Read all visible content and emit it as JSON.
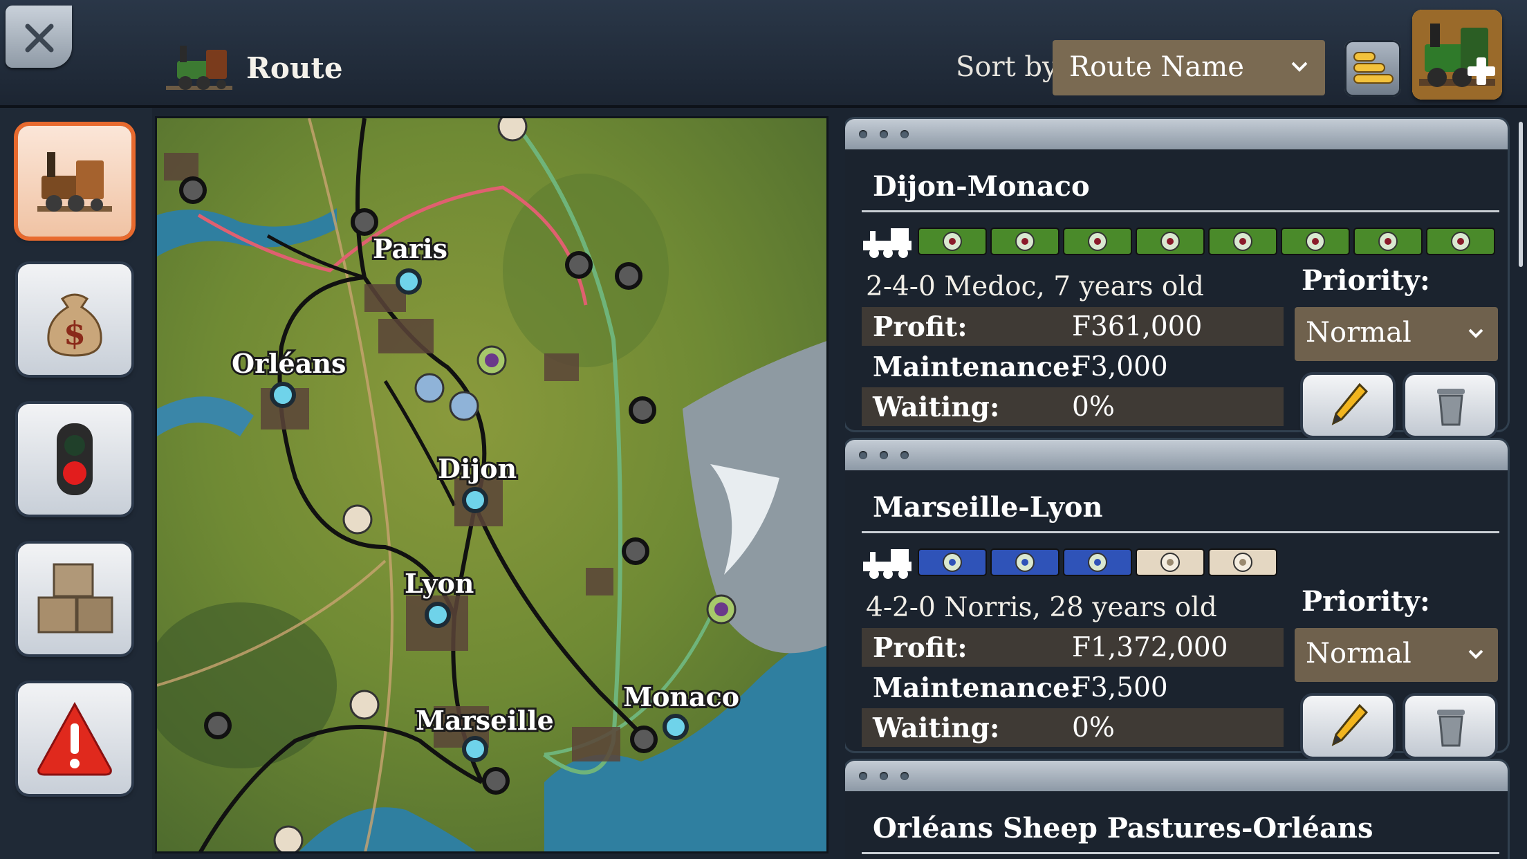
{
  "header": {
    "title": "Route",
    "sort_label": "Sort by:",
    "sort_value": "Route Name",
    "icons": {
      "close": "close-icon",
      "title": "locomotive-icon",
      "sort_order": "sort-order-icon",
      "add_train": "add-train-icon"
    }
  },
  "sidebar": {
    "items": [
      {
        "name": "trains",
        "icon": "locomotive-icon",
        "active": true
      },
      {
        "name": "finances",
        "icon": "money-bag-icon",
        "active": false
      },
      {
        "name": "signals",
        "icon": "traffic-light-icon",
        "active": false
      },
      {
        "name": "cargo",
        "icon": "crates-icon",
        "active": false
      },
      {
        "name": "alerts",
        "icon": "warning-icon",
        "active": false
      }
    ]
  },
  "map": {
    "cities": [
      "Paris",
      "Orléans",
      "Dijon",
      "Lyon",
      "Marseille",
      "Monaco"
    ]
  },
  "routes": [
    {
      "name": "Dijon-Monaco",
      "locomotive": "2-4-0 Medoc, 7 years old",
      "cars": [
        "wine",
        "wine",
        "wine",
        "wine",
        "wine",
        "wine",
        "wine",
        "wine"
      ],
      "profit_label": "Profit:",
      "profit": "F361,000",
      "maintenance_label": "Maintenance:",
      "maintenance": "F3,000",
      "waiting_label": "Waiting:",
      "waiting": "0%",
      "priority_label": "Priority:",
      "priority": "Normal"
    },
    {
      "name": "Marseille-Lyon",
      "locomotive": "4-2-0 Norris, 28 years old",
      "cars": [
        "passengers",
        "passengers",
        "passengers",
        "mail",
        "mail"
      ],
      "profit_label": "Profit:",
      "profit": "F1,372,000",
      "maintenance_label": "Maintenance:",
      "maintenance": "F3,500",
      "waiting_label": "Waiting:",
      "waiting": "0%",
      "priority_label": "Priority:",
      "priority": "Normal"
    },
    {
      "name": "Orléans Sheep Pastures-Orléans"
    }
  ],
  "colors": {
    "wine_car": "#4a8a2a",
    "passenger_car": "#2f53b8",
    "mail_car": "#e4d7c2",
    "active_tab": "#e86a2e",
    "select_bg": "#7a6a52"
  }
}
